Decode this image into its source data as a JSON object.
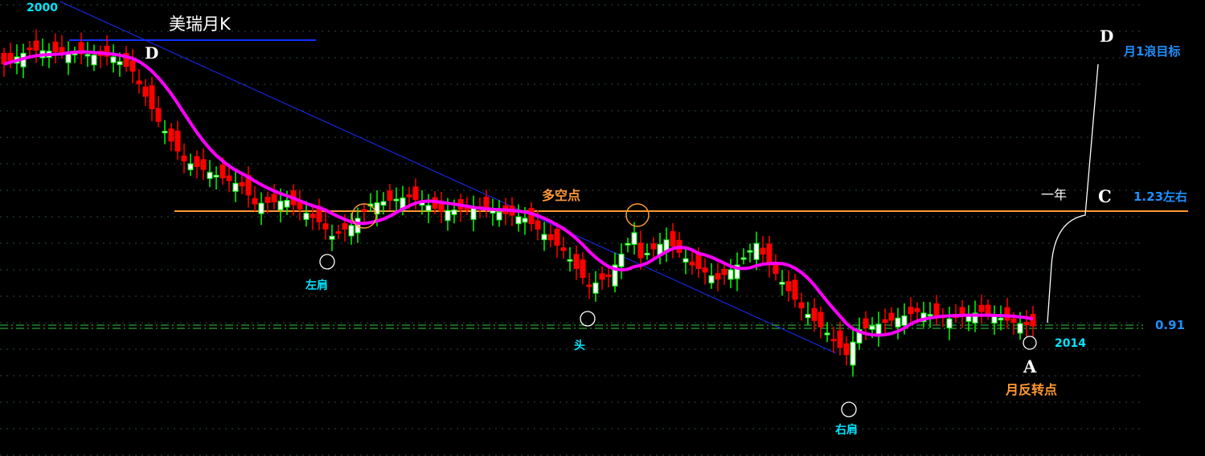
{
  "chart_data": {
    "type": "candlestick",
    "title": "美瑞月K",
    "period": "monthly",
    "start_label": "2000",
    "end_label": "2014",
    "price_range": [
      0.55,
      1.8
    ],
    "close_anchors": [
      [
        0,
        1.64
      ],
      [
        4,
        1.68
      ],
      [
        11,
        1.67
      ],
      [
        17,
        1.66
      ],
      [
        20,
        1.62
      ],
      [
        24,
        1.48
      ],
      [
        28,
        1.37
      ],
      [
        33,
        1.33
      ],
      [
        37,
        1.3
      ],
      [
        39,
        1.25
      ],
      [
        44,
        1.26
      ],
      [
        49,
        1.2
      ],
      [
        51,
        1.16
      ],
      [
        54,
        1.19
      ],
      [
        57,
        1.25
      ],
      [
        63,
        1.27
      ],
      [
        68,
        1.23
      ],
      [
        74,
        1.24
      ],
      [
        81,
        1.21
      ],
      [
        87,
        1.12
      ],
      [
        91,
        1.02
      ],
      [
        94,
        1.05
      ],
      [
        98,
        1.17
      ],
      [
        99,
        1.1
      ],
      [
        103,
        1.15
      ],
      [
        107,
        1.08
      ],
      [
        111,
        1.04
      ],
      [
        114,
        1.08
      ],
      [
        117,
        1.14
      ],
      [
        119,
        1.08
      ],
      [
        124,
        0.96
      ],
      [
        128,
        0.89
      ],
      [
        131,
        0.83
      ],
      [
        133,
        0.9
      ],
      [
        137,
        0.92
      ],
      [
        142,
        0.95
      ],
      [
        147,
        0.93
      ],
      [
        152,
        0.95
      ],
      [
        157,
        0.92
      ],
      [
        160,
        0.91
      ]
    ],
    "ma_color": "#ff00ff",
    "up_color": "#00ff00",
    "down_color": "#ff0000",
    "levels": [
      {
        "name": "long-short point",
        "label": "多空点",
        "price": 1.23,
        "note": "1.23左右",
        "color": "#ff9933"
      },
      {
        "name": "support",
        "price": 0.91,
        "label": "0.91",
        "color": "#33cc33"
      }
    ],
    "annotations": {
      "title": "美瑞月K",
      "year_start": "2000",
      "year_end": "2014",
      "d_top": "D",
      "d_target": "D",
      "target_label": "月1浪目标",
      "c_label": "C",
      "c_price": "1.23左右",
      "one_year": "一年",
      "long_short": "多空点",
      "left_shoulder": "左肩",
      "head": "头",
      "right_shoulder": "右肩",
      "support": "0.91",
      "a_label": "A",
      "reversal": "月反转点"
    }
  }
}
